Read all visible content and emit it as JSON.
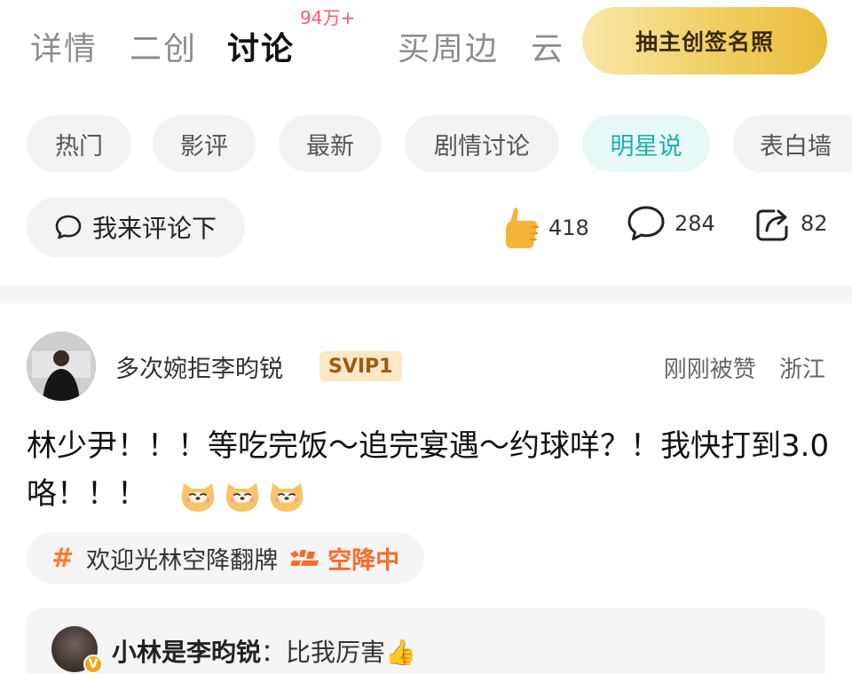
{
  "tabs": {
    "items": [
      {
        "label": "详情"
      },
      {
        "label": "二创"
      },
      {
        "label": "讨论"
      },
      {
        "label": "买周边"
      },
      {
        "label": "云"
      }
    ],
    "active_index": 2,
    "badge": "94万+",
    "promo_button": "抽主创签名照"
  },
  "chips": {
    "items": [
      "热门",
      "影评",
      "最新",
      "剧情讨论",
      "明星说",
      "表白墙"
    ],
    "selected": "明星说"
  },
  "composer": {
    "placeholder": "我来评论下"
  },
  "stats": {
    "likes": "418",
    "comments": "284",
    "shares": "82"
  },
  "post": {
    "username": "多次婉拒李昀锐",
    "vip_badge": "SVIP1",
    "status": "刚刚被赞",
    "location": "浙江",
    "content": "林少尹！！！等吃完饭～追完宴遇～约球咩？！我快打到3.0咯！！！",
    "emoji_count": 3,
    "topic": "欢迎光林空降翻牌",
    "topic_status": "空降中",
    "reply": {
      "author": "小林是李昀锐",
      "separator": "：",
      "text": "比我厉害👍"
    }
  },
  "colors": {
    "accent_teal": "#1ab3a6",
    "badge_red": "#ff5a6e",
    "promo_gold": "#f0cf62",
    "topic_orange": "#ff6a2a"
  },
  "icons": [
    "comment-bubble-icon",
    "thumbs-up-icon",
    "comment-icon",
    "share-icon",
    "hashtag-icon",
    "live-drop-icon",
    "dog-emoji-icon",
    "verified-v-icon"
  ]
}
